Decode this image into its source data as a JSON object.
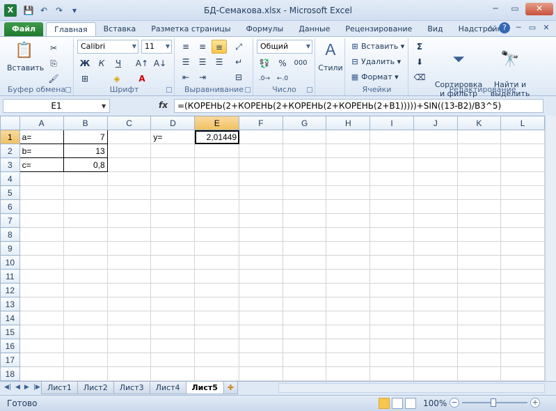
{
  "app": {
    "title": "БД-Семакова.xlsx - Microsoft Excel",
    "icon": "X"
  },
  "tabs": [
    "Файл",
    "Главная",
    "Вставка",
    "Разметка страницы",
    "Формулы",
    "Данные",
    "Рецензирование",
    "Вид",
    "Надстройки"
  ],
  "ribbon": {
    "clipboard": {
      "label": "Буфер обмена",
      "paste": "Вставить"
    },
    "font": {
      "label": "Шрифт",
      "name": "Calibri",
      "size": "11",
      "bold": "Ж",
      "italic": "К",
      "underline": "Ч"
    },
    "alignment": {
      "label": "Выравнивание"
    },
    "number": {
      "label": "Число",
      "format": "Общий",
      "percent": "%",
      "thousands": "000"
    },
    "styles": {
      "label": "Стили"
    },
    "cells": {
      "label": "Ячейки",
      "insert": "Вставить",
      "delete": "Удалить",
      "format": "Формат"
    },
    "editing": {
      "label": "Редактирование",
      "sort": "Сортировка\nи фильтр",
      "find": "Найти и\nвыделить"
    }
  },
  "formula_bar": {
    "name_box": "E1",
    "fx": "fx",
    "formula": "=(КОРЕНЬ(2+КОРЕНЬ(2+КОРЕНЬ(2+КОРЕНЬ(2+B1)))))+SIN((13-B2)/B3^5)"
  },
  "columns": [
    "A",
    "B",
    "C",
    "D",
    "E",
    "F",
    "G",
    "H",
    "I",
    "J",
    "K",
    "L"
  ],
  "rows": [
    {
      "n": "1",
      "A": "a=",
      "B": "7",
      "D": "y=",
      "E": "2,01449"
    },
    {
      "n": "2",
      "A": "b=",
      "B": "13"
    },
    {
      "n": "3",
      "A": "c=",
      "B": "0,8"
    },
    {
      "n": "4"
    },
    {
      "n": "5"
    },
    {
      "n": "6"
    },
    {
      "n": "7"
    },
    {
      "n": "8"
    },
    {
      "n": "9"
    },
    {
      "n": "10"
    },
    {
      "n": "11"
    },
    {
      "n": "12"
    },
    {
      "n": "13"
    },
    {
      "n": "14"
    },
    {
      "n": "15"
    },
    {
      "n": "16"
    },
    {
      "n": "17"
    },
    {
      "n": "18"
    }
  ],
  "sheets": [
    "Лист1",
    "Лист2",
    "Лист3",
    "Лист4",
    "Лист5"
  ],
  "active_sheet": "Лист5",
  "status": {
    "text": "Готово",
    "zoom": "100%"
  }
}
